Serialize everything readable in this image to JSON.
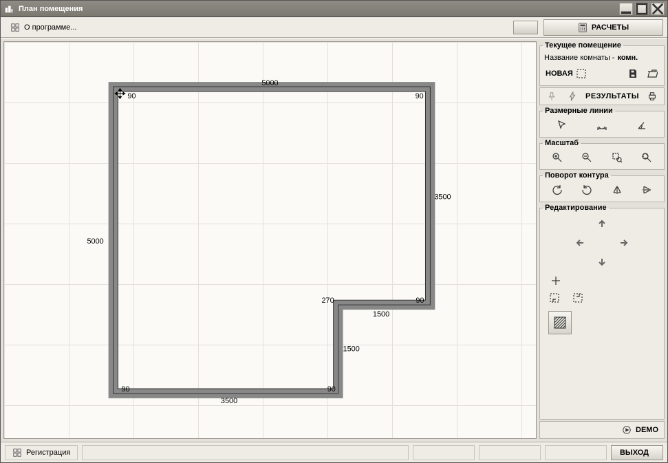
{
  "title": "План помещения",
  "toolbar": {
    "about_label": "О программе...",
    "calculations_label": "РАСЧЕТЫ"
  },
  "sidepanel": {
    "current_room": {
      "legend": "Текущее помещение",
      "name_label": "Название комнаты -",
      "name_value": "комн.",
      "new_label": "НОВАЯ"
    },
    "results_label": "РЕЗУЛЬТАТЫ",
    "dimension_lines_legend": "Размерные линии",
    "scale_legend": "Масштаб",
    "rotation_legend": "Поворот контура",
    "editing_legend": "Редактирование",
    "demo_label": "DEMO"
  },
  "statusbar": {
    "registration_label": "Регистрация",
    "exit_label": "ВЫХОД"
  },
  "plan": {
    "segments": {
      "top_length": "5000",
      "top_left_angle": "90",
      "top_right_angle": "90",
      "right_upper_length": "3500",
      "left_length": "5000",
      "notch_top_angle": "270",
      "upper_right_inner_angle": "90",
      "notch_horiz_length": "1500",
      "notch_vert_length": "1500",
      "bottom_left_angle": "90",
      "bottom_right_angle": "90",
      "bottom_length": "3500"
    }
  }
}
